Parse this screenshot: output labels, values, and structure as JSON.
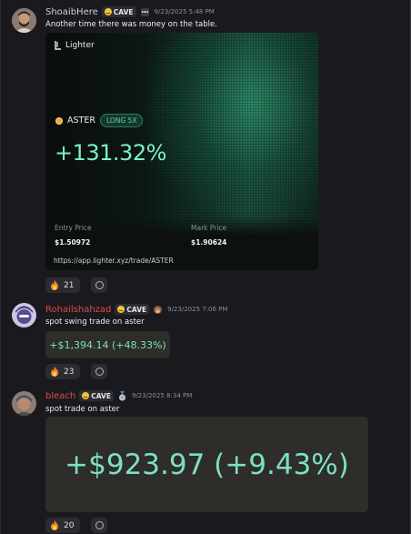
{
  "messages": [
    {
      "username": "ShoaibHere",
      "tag": "CAVE",
      "timestamp": "9/23/2025 5:48 PM",
      "text": "Another time there was money on the table.",
      "card": {
        "brand": "Lighter",
        "asset": "ASTER",
        "leverage": "LONG 5X",
        "pnl": "+131.32%",
        "entry_label": "Entry Price",
        "entry_value": "$1.50972",
        "mark_label": "Mark Price",
        "mark_value": "$1.90624",
        "url": "https://app.lighter.xyz/trade/ASTER"
      },
      "reaction_count": "21"
    },
    {
      "username": "Rohailshahzad",
      "tag": "CAVE",
      "timestamp": "9/23/2025 7:06 PM",
      "text": "spot swing trade on aster",
      "pnl_text": "+$1,394.14 (+48.33%)",
      "reaction_count": "23"
    },
    {
      "username": "bleach",
      "tag": "CAVE",
      "timestamp": "9/23/2025 8:34 PM",
      "text": "spot trade on aster",
      "pnl_text": "+$923.97 (+9.43%)",
      "reaction_count": "20"
    }
  ],
  "icons": {
    "reaction": "fire-icon",
    "add_reaction": "add-reaction-icon"
  },
  "colors": {
    "background": "#1a1a1e",
    "username_red": "#e0484a",
    "pnl_green": "#7cf2c2",
    "pnl_teal": "#7ce0c4"
  }
}
